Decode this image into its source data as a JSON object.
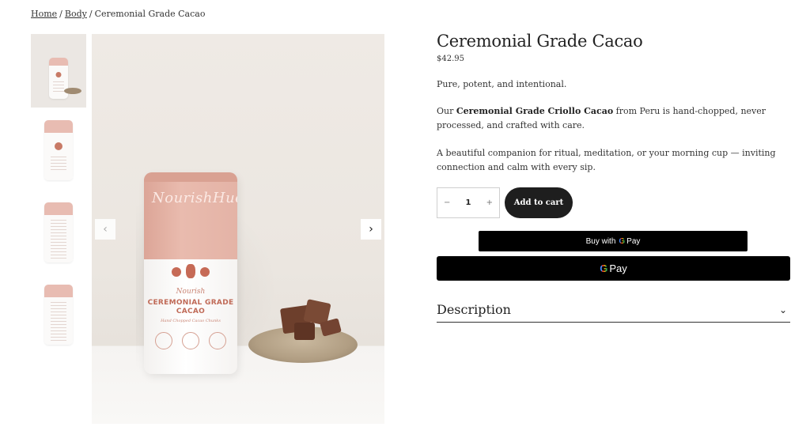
{
  "breadcrumb": {
    "home": "Home",
    "category": "Body",
    "current": "Ceremonial Grade Cacao",
    "separator": "/"
  },
  "gallery": {
    "prev_icon": "chevron-left-icon",
    "next_icon": "chevron-right-icon",
    "prev_glyph": "‹",
    "next_glyph": "›",
    "brand_on_product": "NourishHue",
    "product_label_line1": "Nourish",
    "product_label_line2": "CEREMONIAL GRADE CACAO",
    "product_label_line3": "Hand Chopped Cacao Chunks"
  },
  "product": {
    "title": "Ceremonial Grade Cacao",
    "price": "$42.95",
    "tagline": "Pure, potent, and intentional.",
    "desc_prefix": "Our ",
    "desc_bold": "Ceremonial Grade Criollo Cacao",
    "desc_suffix": " from Peru is hand-chopped, never processed, and crafted with care.",
    "desc2": "A beautiful companion for ritual, meditation, or your morning cup — inviting connection and calm with every sip."
  },
  "quantity": {
    "minus": "−",
    "value": "1",
    "plus": "+"
  },
  "actions": {
    "add_to_cart": "Add to cart",
    "buy_with": "Buy with",
    "g_letter": "G",
    "pay": "Pay"
  },
  "description_section": {
    "label": "Description",
    "chevron": "⌄"
  }
}
